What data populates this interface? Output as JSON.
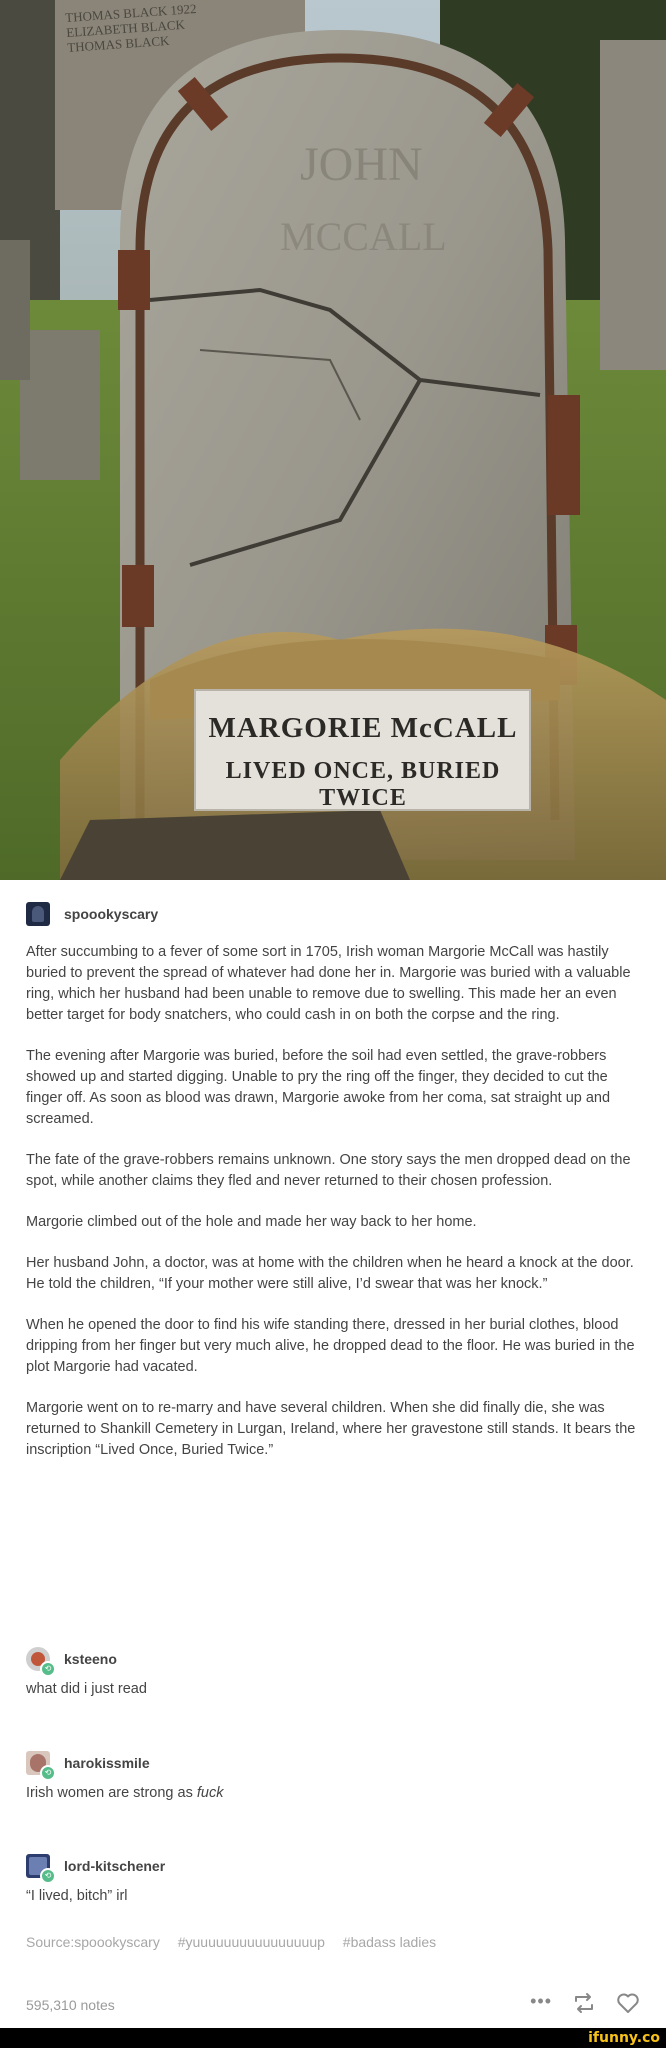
{
  "photo": {
    "plaque_line1": "MARGORIE McCALL",
    "plaque_line2": "LIVED ONCE, BURIED TWICE",
    "background_stone_text": [
      "THOMAS BLACK 1922",
      "ELIZABETH BLACK",
      "THOMAS BLACK"
    ]
  },
  "post": {
    "author": "spoookyscary",
    "paragraphs": [
      "After succumbing to a fever of some sort in 1705, Irish woman Margorie McCall was hastily buried to prevent the spread of whatever had done her in. Margorie was buried with a valuable ring, which her husband had been unable to remove due to swelling. This made her an even better target for body snatchers, who could cash in on both the corpse and the ring.",
      "The evening after Margorie was buried, before the soil had even settled, the grave-robbers showed up and started digging. Unable to pry the ring off the finger, they decided to cut the finger off. As soon as blood was drawn, Margorie awoke from her coma, sat straight up and screamed.",
      "The fate of the grave-robbers remains unknown. One story says the men dropped dead on the spot, while another claims they fled and never returned to their chosen profession.",
      "Margorie climbed out of the hole and made her way back to her home.",
      "Her husband John, a doctor, was at home with the children when he heard a knock at the door. He told the children, “If your mother were still alive, I’d swear that was her knock.”",
      "When he opened the door to find his wife standing there, dressed in her burial clothes, blood dripping from her finger but very much alive, he dropped dead to the floor. He was buried in the plot Margorie had vacated.",
      "Margorie went on to re-marry and have several children. When she did finally die, she was returned to Shankill Cemetery in Lurgan, Ireland, where her gravestone still stands. It bears the inscription “Lived Once, Buried Twice.”"
    ]
  },
  "reblogs": [
    {
      "user": "ksteeno",
      "text": "what did i just read",
      "avatar": "ksteeno"
    },
    {
      "user": "harokissmile",
      "text_before": "Irish women are strong as ",
      "text_italic": "fuck",
      "avatar": "haro"
    },
    {
      "user": "lord-kitschener",
      "text": "“I lived, bitch” irl",
      "avatar": "lord"
    }
  ],
  "tags": {
    "source": "Source:spoookyscary",
    "tag1": "#yuuuuuuuuuuuuuuuup",
    "tag2": "#badass ladies"
  },
  "footer": {
    "notes": "595,310 notes",
    "more_icon": "ellipsis-icon",
    "reblog_icon": "reblog-icon",
    "like_icon": "heart-icon"
  },
  "watermark": "ifunny.co",
  "colors": {
    "accent_green": "#56bc8a",
    "text": "#444444",
    "muted": "#a7a7a7"
  }
}
